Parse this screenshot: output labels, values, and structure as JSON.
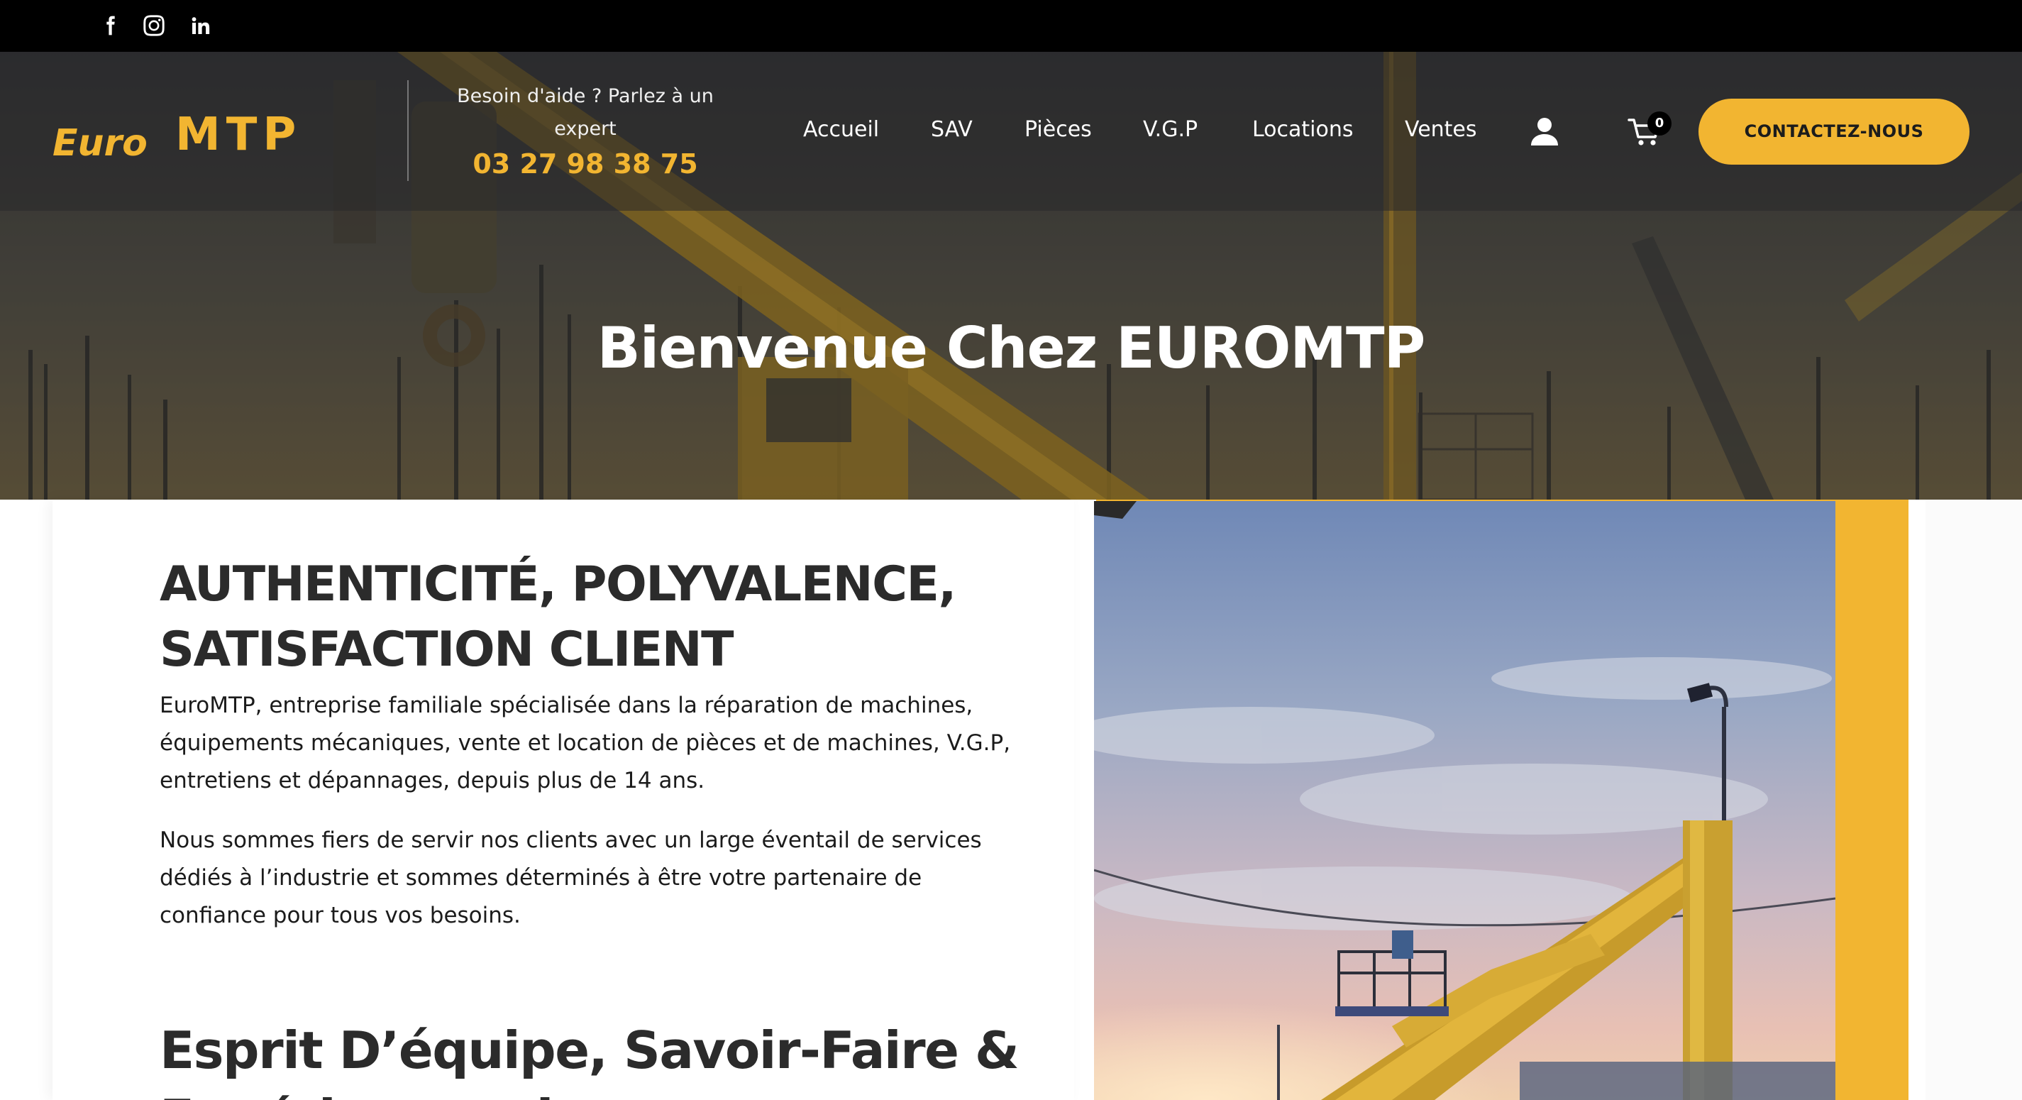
{
  "social": {
    "facebook_icon": "facebook-icon",
    "instagram_icon": "instagram-icon",
    "linkedin_icon": "linkedin-icon"
  },
  "header": {
    "logo_text_left": "Euro",
    "logo_text_right": "MTP",
    "help_text": "Besoin d'aide ? Parlez à un expert",
    "phone": "03 27 98 38 75",
    "nav": [
      {
        "label": "Accueil"
      },
      {
        "label": "SAV"
      },
      {
        "label": "Pièces"
      },
      {
        "label": "V.G.P"
      },
      {
        "label": "Locations"
      },
      {
        "label": "Ventes"
      }
    ],
    "user_icon": "user-icon",
    "cart_icon": "cart-icon",
    "cart_count": "0",
    "cta_label": "CONTACTEZ-NOUS"
  },
  "hero": {
    "title": "Bienvenue Chez EUROMTP"
  },
  "main": {
    "title": "AUTHENTICITÉ, POLYVALENCE, SATISFACTION CLIENT",
    "paragraphs": [
      "EuroMTP, entreprise familiale spécialisée dans la réparation de machines, équipements mécaniques, vente et location de pièces et de machines, V.G.P, entretiens et dépannages, depuis plus de 14 ans.",
      "Nous sommes fiers de servir nos clients avec un large éventail de services dédiés à l’industrie et sommes déterminés à être votre partenaire de confiance pour tous vos besoins."
    ],
    "subtitle": "Esprit D’équipe, Savoir-Faire & Expérimentation"
  },
  "colors": {
    "accent": "#f2b531",
    "topbar": "#000000",
    "text": "#2b2b2b"
  }
}
